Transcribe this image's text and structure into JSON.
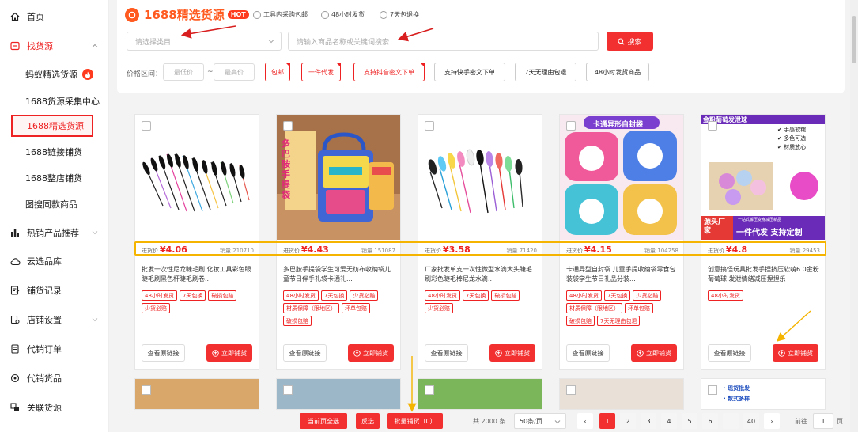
{
  "sidebar": {
    "items": [
      {
        "label": "首页",
        "icon": "home-icon"
      },
      {
        "label": "找货源",
        "icon": "find-source-icon",
        "expanded": true
      },
      {
        "label": "热销产品推荐",
        "icon": "hot-products-icon"
      },
      {
        "label": "云选品库",
        "icon": "cloud-library-icon"
      },
      {
        "label": "铺货记录",
        "icon": "record-icon"
      },
      {
        "label": "店铺设置",
        "icon": "store-settings-icon"
      },
      {
        "label": "代销订单",
        "icon": "orders-icon"
      },
      {
        "label": "代销货品",
        "icon": "goods-icon"
      },
      {
        "label": "关联货源",
        "icon": "link-source-icon"
      }
    ],
    "sub_items": [
      {
        "label": "蚂蚁精选货源"
      },
      {
        "label": "1688货源采集中心"
      },
      {
        "label": "1688精选货源",
        "selected": true
      },
      {
        "label": "1688链接铺货"
      },
      {
        "label": "1688整店铺货"
      },
      {
        "label": "图搜同款商品"
      }
    ]
  },
  "header": {
    "brand_title": "1688精选货源",
    "hot_badge": "HOT",
    "perks": [
      "工具内采购包邮",
      "48小时发货",
      "7天包退换"
    ]
  },
  "filters": {
    "category_placeholder": "请选择类目",
    "search_placeholder": "请输入商品名称或关键词搜索",
    "search_button": "搜索",
    "price_label": "价格区间：",
    "min_placeholder": "最低价",
    "max_placeholder": "最高价",
    "dash": "~",
    "chips": [
      {
        "label": "包邮",
        "active": true
      },
      {
        "label": "一件代发",
        "active": true
      },
      {
        "label": "支持抖音密文下单",
        "active": true
      },
      {
        "label": "支持快手密文下单",
        "active": false
      },
      {
        "label": "7天无理由包退",
        "active": false
      },
      {
        "label": "48小时发货商品",
        "active": false
      }
    ]
  },
  "products": [
    {
      "price_label": "进货价",
      "price": "¥4.06",
      "sales": "销量 210710",
      "title": "批发一次性尼龙睫毛刷 化妆工具彩色眼睫毛刷黑色杆睫毛刷卷...",
      "tags": [
        "48小时发货",
        "7天包换",
        "破损包赔",
        "少货必赔"
      ],
      "btn_link": "查看原链接",
      "btn_push": "立即铺货"
    },
    {
      "price_label": "进货价",
      "price": "¥4.43",
      "sales": "销量 151087",
      "title": "多巴胺手提袋学生可爱无纺布收纳袋儿童节日伴手礼袋卡通礼...",
      "tags": [
        "48小时发货",
        "7天包换",
        "少货必赔",
        "材质保障（限地区）",
        "坏单包赔",
        "破损包赔"
      ],
      "btn_link": "查看原链接",
      "btn_push": "立即铺货",
      "thumb_text": "多巴胺手提袋"
    },
    {
      "price_label": "进货价",
      "price": "¥3.58",
      "sales": "销量 71420",
      "title": "厂家批发单支一次性微型水滴大头睫毛刷彩色睫毛棒尼龙水滴...",
      "tags": [
        "48小时发货",
        "7天包换",
        "破损包赔",
        "少货必赔"
      ],
      "btn_link": "查看原链接",
      "btn_push": "立即铺货"
    },
    {
      "price_label": "进货价",
      "price": "¥4.15",
      "sales": "销量 104258",
      "title": "卡通异型自封袋 儿童手提收纳袋零食包装袋学生节日礼品分装...",
      "tags": [
        "48小时发货",
        "7天包换",
        "少货必赔",
        "材质保障（限地区）",
        "坏单包赔",
        "破损包赔",
        "7天无理由包退"
      ],
      "btn_link": "查看原链接",
      "btn_push": "立即铺货",
      "thumb_text": "卡通异形自封袋"
    },
    {
      "price_label": "进货价",
      "price": "¥4.8",
      "sales": "销量 29453",
      "title": "创意搞怪玩具批发手捏挤压软萌6.0金粉葡萄球 发泄情绪减压捏捏乐",
      "tags": [
        "48小时发货"
      ],
      "btn_link": "查看原链接",
      "btn_push": "立即铺货",
      "thumb_text": "金粉葡萄发泄球",
      "thumb_features": [
        "手感软糯",
        "多色可选",
        "材质放心"
      ],
      "thumb_banner": "一件代发 支持定制",
      "thumb_factory": "源头厂家",
      "thumb_small": "一站式解压变身减压新品"
    }
  ],
  "row2_thumb_text": [
    "现货批发",
    "数式多样"
  ],
  "pagination": {
    "select_all_page": "当前页全选",
    "invert": "反选",
    "batch": "批量铺货（0）",
    "total": "共 2000 条",
    "page_size": "50条/页",
    "pages": [
      "1",
      "2",
      "3",
      "4",
      "5",
      "6",
      "...",
      "40"
    ],
    "goto_label": "前往",
    "goto_value": "1",
    "page_unit": "页"
  }
}
